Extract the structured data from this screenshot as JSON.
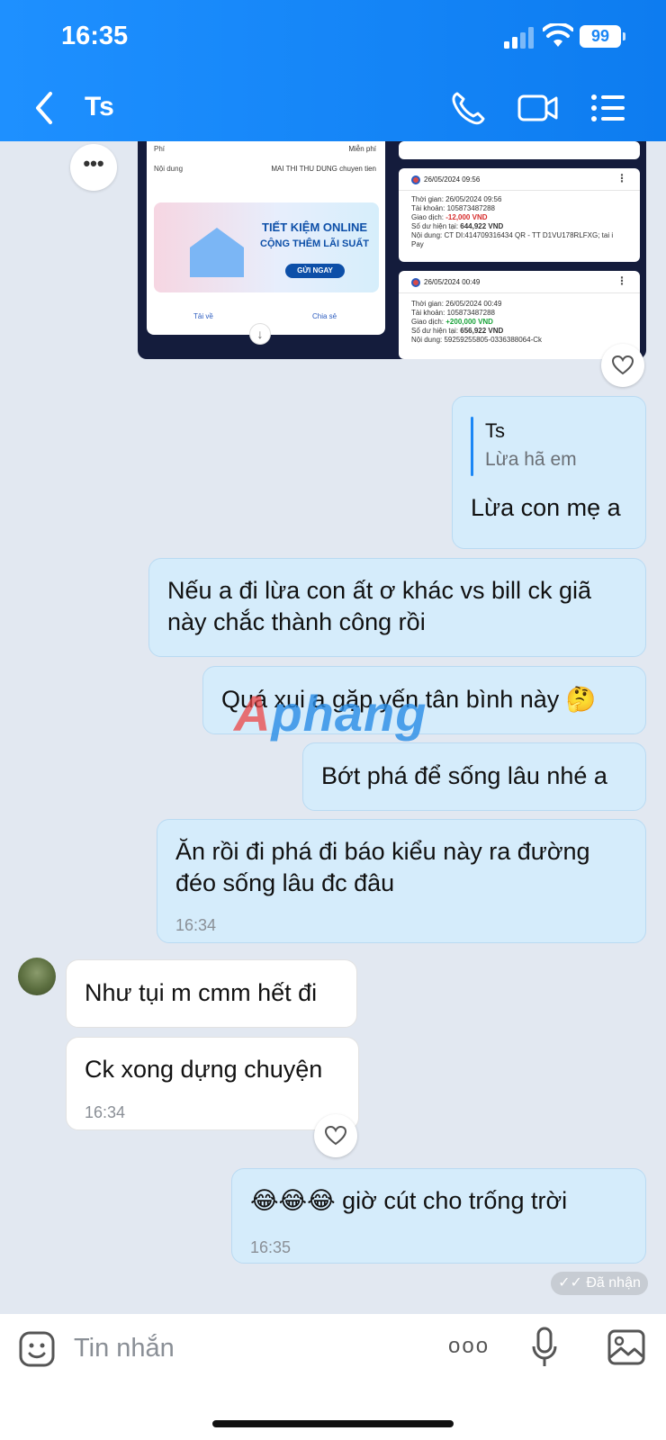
{
  "status_bar": {
    "time": "16:35",
    "battery": "99"
  },
  "header": {
    "title": "Ts"
  },
  "attachments": {
    "receipt": {
      "fee_label": "Phí",
      "fee_value": "Miễn phí",
      "content_label": "Nội dung",
      "content_value": "MAI THI THU DUNG chuyen tien",
      "banner_title": "TIẾT KIỆM ONLINE",
      "banner_subtitle": "CỘNG THÊM LÃI SUẤT",
      "banner_button": "GỬI NGAY",
      "download_label": "Tải về",
      "share_label": "Chia sẻ"
    },
    "transactions": [
      {
        "date": "26/05/2024 09:56",
        "time_line": "Thời gian: 26/05/2024 09:56",
        "account_line": "Tài khoản: 105873487288",
        "txn_label": "Giao dịch: ",
        "txn_amount": "-12,000 VND",
        "balance_label": "Số dư hiện tại: ",
        "balance_value": "644,922 VND",
        "content_line1": "Nội dung: CT DI:414709316434 QR - TT D1VU178RLFXG; tai i",
        "content_line2": "Pay"
      },
      {
        "date": "26/05/2024 00:49",
        "time_line": "Thời gian: 26/05/2024 00:49",
        "account_line": "Tài khoản: 105873487288",
        "txn_label": "Giao dịch: ",
        "txn_amount": "+200,000 VND",
        "balance_label": "Số dư hiện tại: ",
        "balance_value": "656,922 VND",
        "content_line1": "Nội dung: 59259255805-0336388064-Ck",
        "content_line2": ""
      }
    ]
  },
  "messages": {
    "quoted_name": "Ts",
    "quoted_text": "Lừa hã em",
    "reply_text": "Lừa con mẹ a",
    "m2_line1": "Nếu a đi lừa con ất ơ khác vs bill ck giã",
    "m2_line2": "này chắc thành công rồi",
    "m3": "Quá xui a gặp yến tân bình này 🤔",
    "m4": "Bớt phá để sống lâu nhé a",
    "m5_line1": "Ăn rồi đi phá đi báo kiểu này ra đường",
    "m5_line2": "đéo sống lâu đc đâu",
    "m5_time": "16:34",
    "r1": "Như tụi m cmm hết đi",
    "r2": "Ck xong dựng chuyện",
    "r2_time": "16:34",
    "m6": "😂😂😂  giờ cút cho trống trời",
    "m6_time": "16:35",
    "delivery_status": "Đã nhận"
  },
  "watermark": {
    "part1": "A",
    "part2": "phang"
  },
  "composer": {
    "placeholder": "Tin nhắn"
  },
  "colors": {
    "header": "#1e90ff",
    "outgoing_bubble": "#d5ecfb",
    "incoming_bubble": "#ffffff",
    "background": "#e2e8f1"
  }
}
